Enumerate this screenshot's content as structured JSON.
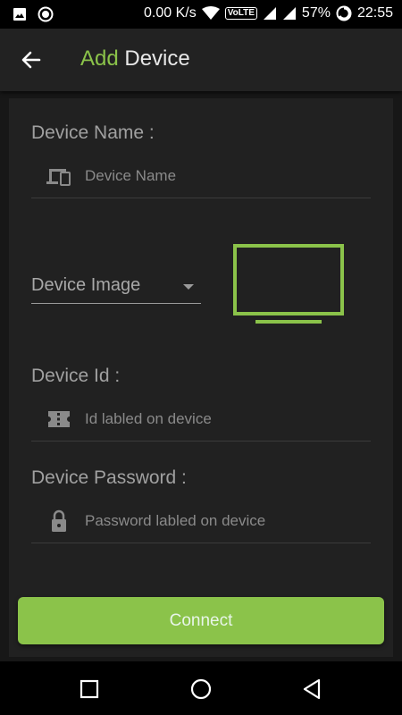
{
  "status_bar": {
    "net_speed": "0.00 K/s",
    "volte": "VoLTE",
    "battery": "57%",
    "time": "22:55"
  },
  "app_bar": {
    "title_accent": "Add",
    "title_rest": "Device"
  },
  "form": {
    "device_name_label": "Device Name :",
    "device_name_placeholder": "Device Name",
    "device_image_label": "Device Image",
    "device_id_label": "Device Id :",
    "device_id_placeholder": "Id labled on device",
    "device_password_label": "Device Password :",
    "device_password_placeholder": "Password labled on device"
  },
  "connect_label": "Connect",
  "icons": {
    "back": "arrow-left-icon",
    "device_name": "devices-icon",
    "device_id": "ticket-icon",
    "password": "lock-icon",
    "preview": "tv-icon"
  },
  "colors": {
    "accent": "#8bc34a",
    "background": "#171717",
    "card": "#212121"
  }
}
